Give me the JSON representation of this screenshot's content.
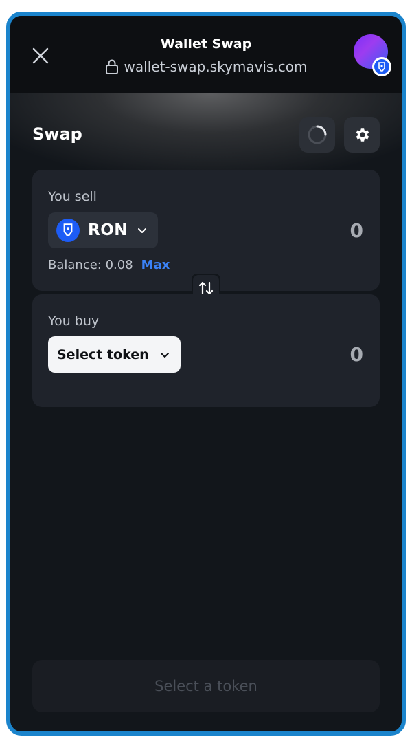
{
  "header": {
    "title": "Wallet Swap",
    "url": "wallet-swap.skymavis.com"
  },
  "swap": {
    "title": "Swap"
  },
  "sell": {
    "label": "You sell",
    "token": "RON",
    "amount": "0",
    "balance_label": "Balance: 0.08",
    "max_label": "Max"
  },
  "buy": {
    "label": "You buy",
    "select_label": "Select token",
    "amount": "0"
  },
  "action": {
    "label": "Select a token"
  },
  "colors": {
    "frame_border": "#1b84cc",
    "background": "#12161b",
    "card": "#1f232b",
    "accent_link": "#3b82f6",
    "ronin_blue": "#1d5cf5"
  },
  "icons": [
    "close-icon",
    "lock-icon",
    "ronin-icon",
    "spinner-icon",
    "gear-icon",
    "chevron-down-icon",
    "swap-arrows-icon"
  ]
}
